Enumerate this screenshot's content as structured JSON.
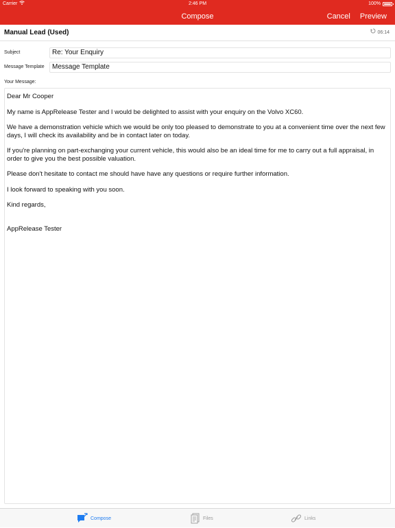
{
  "status_bar": {
    "carrier": "Carrier",
    "time": "2:46 PM",
    "battery": "100%"
  },
  "navbar": {
    "title": "Compose",
    "cancel": "Cancel",
    "preview": "Preview"
  },
  "lead": {
    "name": "Manual Lead (Used)",
    "time": "06:14"
  },
  "form": {
    "subject_label": "Subject",
    "subject_value": "Re: Your Enquiry",
    "template_label": "Message Template",
    "template_value": "Message Template",
    "message_label": "Your Message:"
  },
  "message": {
    "p1": "Dear Mr Cooper",
    "p2": "My name is AppRelease Tester and I would be delighted to assist with your enquiry on the Volvo XC60.",
    "p3": "We have a demonstration vehicle which we would be only too pleased to demonstrate to you at a convenient time over the next few days, I will check its availability and be in contact later on today.",
    "p4": "If you're planning on part-exchanging your current vehicle, this would also be an ideal time for me to carry out a full appraisal, in order to give you the best possible valuation.",
    "p5": "Please don't hesitate to contact me should have have any questions or require further information.",
    "p6": "I look forward to speaking with you soon.",
    "p7": "Kind regards,",
    "p8": "AppRelease Tester"
  },
  "tabs": [
    {
      "label": "Compose",
      "icon": "compose-icon",
      "active": true
    },
    {
      "label": "Files",
      "icon": "files-icon",
      "active": false
    },
    {
      "label": "Links",
      "icon": "links-icon",
      "active": false
    }
  ],
  "colors": {
    "accent_red": "#e02a20",
    "tab_active": "#1e7cf0",
    "tab_inactive": "#9a9a9a"
  }
}
